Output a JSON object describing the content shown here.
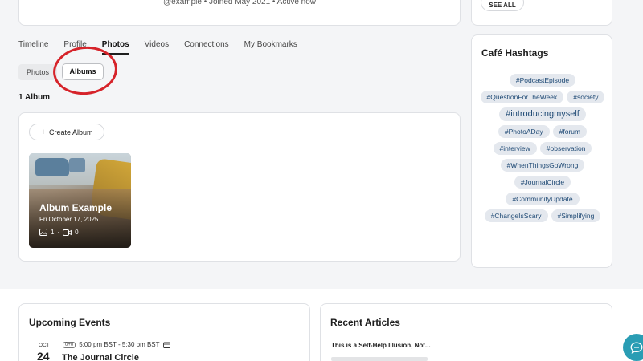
{
  "profile": {
    "meta_text": "@example • Joined May 2021 • Active now"
  },
  "sidebar_top": {
    "see_all_label": "SEE ALL"
  },
  "tabs": [
    {
      "label": "Timeline",
      "active": false
    },
    {
      "label": "Profile",
      "active": false
    },
    {
      "label": "Photos",
      "active": true
    },
    {
      "label": "Videos",
      "active": false
    },
    {
      "label": "Connections",
      "active": false
    },
    {
      "label": "My Bookmarks",
      "active": false
    }
  ],
  "subtabs": {
    "photos_label": "Photos",
    "albums_label": "Albums",
    "selected": "Albums"
  },
  "albums": {
    "count_label": "1 Album",
    "create_label": "Create Album",
    "items": [
      {
        "title": "Album Example",
        "date": "Fri October 17, 2025",
        "photo_count": "1",
        "video_count": "0"
      }
    ]
  },
  "hashtags": {
    "title": "Café Hashtags",
    "items": [
      "#PodcastEpisode",
      "#QuestionForTheWeek",
      "#society",
      "#introducingmyself",
      "#PhotoADay",
      "#forum",
      "#interview",
      "#observation",
      "#WhenThingsGoWrong",
      "#JournalCircle",
      "#CommunityUpdate",
      "#ChangeIsScary",
      "#Simplifying"
    ]
  },
  "events": {
    "title": "Upcoming Events",
    "month": "OCT",
    "day": "24",
    "format_badge": "0+0",
    "time": "5:00 pm BST - 5:30 pm BST",
    "name": "The Journal Circle"
  },
  "articles": {
    "title": "Recent Articles",
    "items": [
      "This is a Self-Help Illusion, Not..."
    ]
  },
  "colors": {
    "accent_teal": "#2a9db4",
    "annotation_red": "#d6232a",
    "tag_bg": "#e4e8ee",
    "tag_text": "#1f4a75"
  }
}
